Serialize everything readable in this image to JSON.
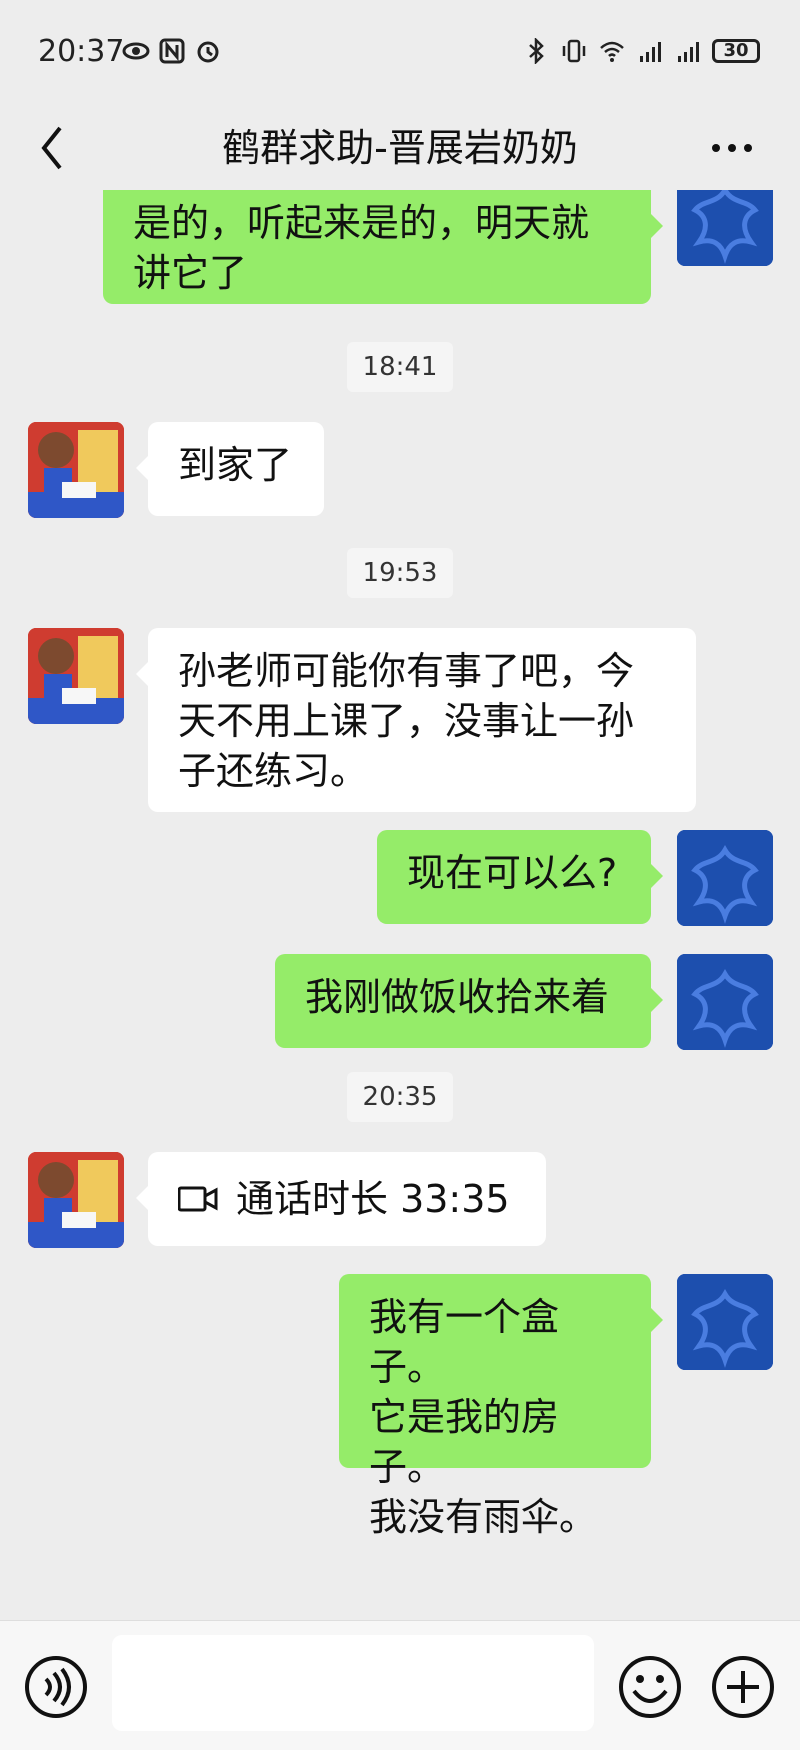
{
  "status": {
    "time": "20:37",
    "battery": "30"
  },
  "header": {
    "title": "鹤群求助-晋展岩奶奶"
  },
  "messages": [
    {
      "type": "sent",
      "text": "是的，听起来是的，明天就\n讲它了"
    },
    {
      "type": "timestamp",
      "text": "18:41"
    },
    {
      "type": "received",
      "text": "到家了"
    },
    {
      "type": "timestamp",
      "text": "19:53"
    },
    {
      "type": "received",
      "text": "孙老师可能你有事了吧，今\n天不用上课了，没事让一孙\n子还练习。"
    },
    {
      "type": "sent",
      "text": "现在可以么?"
    },
    {
      "type": "sent",
      "text": "我刚做饭收拾来着"
    },
    {
      "type": "timestamp",
      "text": "20:35"
    },
    {
      "type": "received_call",
      "text": "通话时长 33:35"
    },
    {
      "type": "sent",
      "text": "我有一个盒子。\n它是我的房子。\n我没有雨伞。"
    }
  ],
  "input": {
    "value": ""
  },
  "colors": {
    "sent_bubble": "#95ec69",
    "received_bubble": "#ffffff",
    "background": "#ededed",
    "self_avatar": "#1d4fae"
  },
  "icons": [
    "back-icon",
    "more-icon",
    "video-call-icon",
    "voice-input-icon",
    "emoji-icon",
    "plus-icon"
  ]
}
